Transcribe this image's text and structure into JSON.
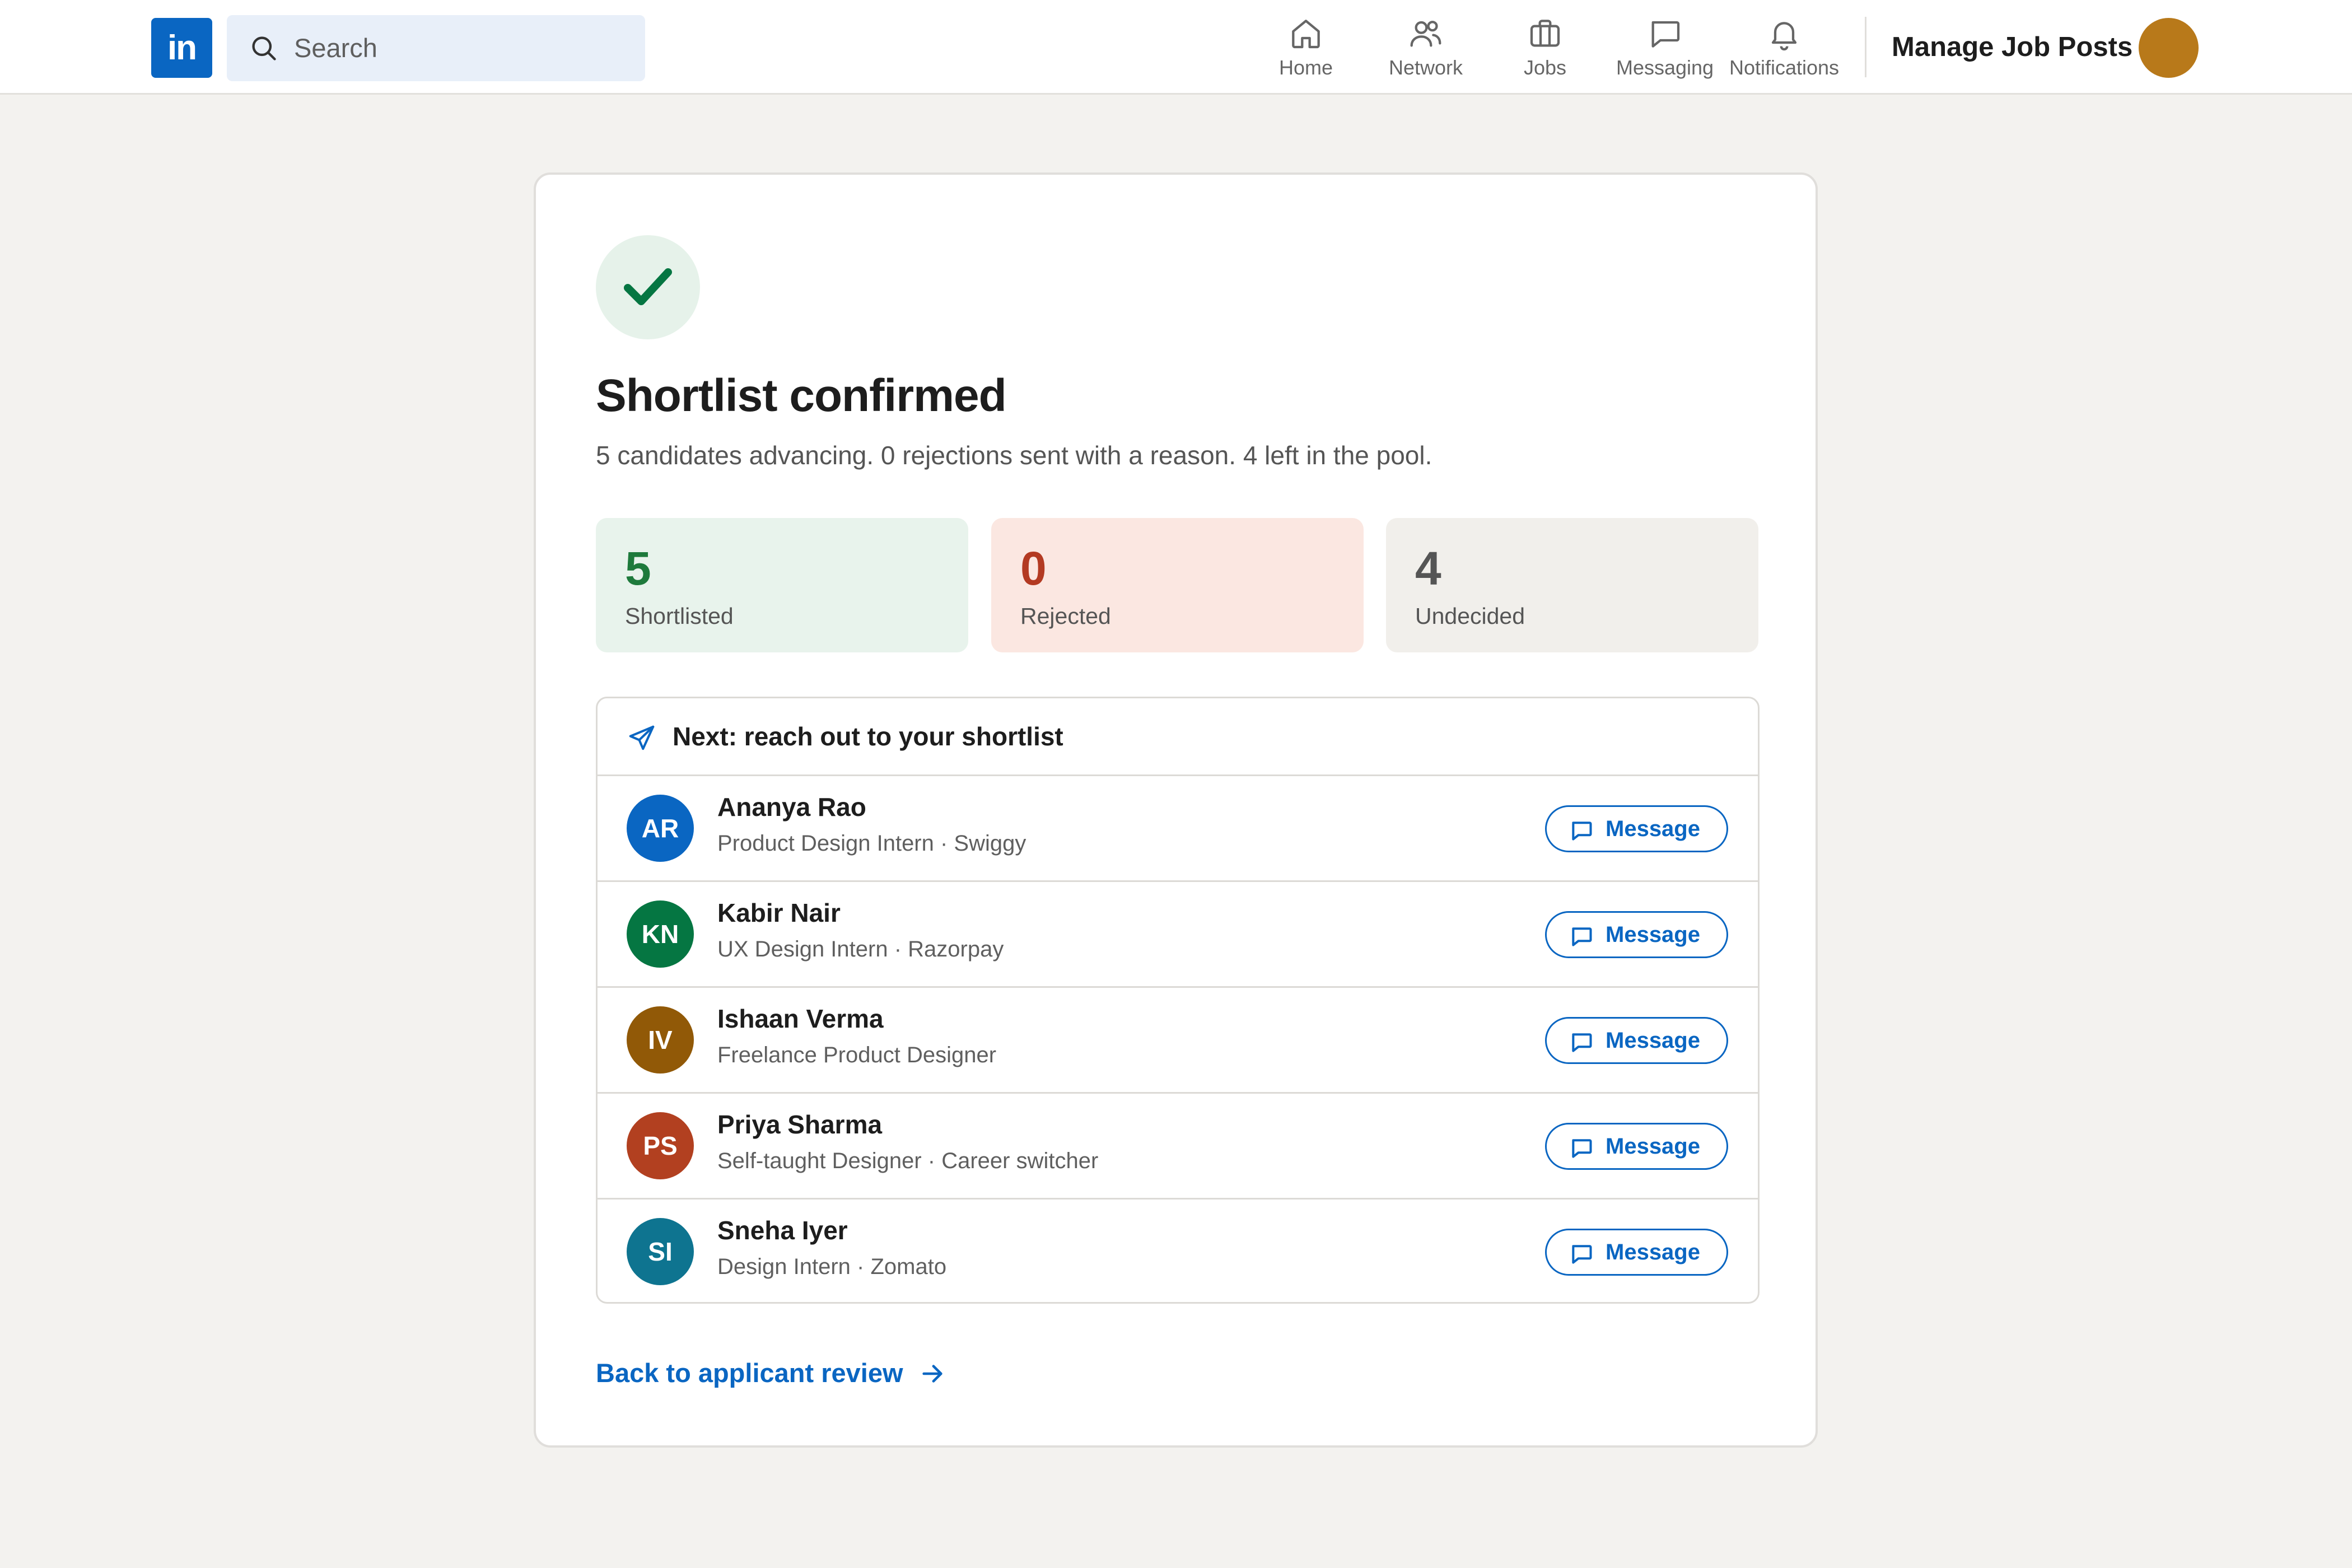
{
  "nav": {
    "logo_text": "in",
    "search_placeholder": "Search",
    "items": [
      {
        "label": "Home",
        "icon": "home-icon"
      },
      {
        "label": "Network",
        "icon": "network-icon"
      },
      {
        "label": "Jobs",
        "icon": "briefcase-icon"
      },
      {
        "label": "Messaging",
        "icon": "chat-icon"
      },
      {
        "label": "Notifications",
        "icon": "bell-icon"
      }
    ],
    "manage_label": "Manage Job Posts",
    "avatar_color": "#b8791a"
  },
  "confirm": {
    "title": "Shortlist confirmed",
    "subtitle": "5 candidates advancing. 0 rejections sent with a reason. 4 left in the pool.",
    "stats": [
      {
        "value": "5",
        "label": "Shortlisted",
        "color": "#1e7a3c"
      },
      {
        "value": "0",
        "label": "Rejected",
        "color": "#b33a22"
      },
      {
        "value": "4",
        "label": "Undecided",
        "color": "#555555"
      }
    ],
    "next_heading": "Next: reach out to your shortlist",
    "message_label": "Message",
    "candidates": [
      {
        "initials": "AR",
        "name": "Ananya Rao",
        "subtitle": "Product Design Intern · Swiggy",
        "color": "#0a66c2"
      },
      {
        "initials": "KN",
        "name": "Kabir Nair",
        "subtitle": "UX Design Intern · Razorpay",
        "color": "#057642"
      },
      {
        "initials": "IV",
        "name": "Ishaan Verma",
        "subtitle": "Freelance Product Designer",
        "color": "#915907"
      },
      {
        "initials": "PS",
        "name": "Priya Sharma",
        "subtitle": "Self-taught Designer · Career switcher",
        "color": "#b24020"
      },
      {
        "initials": "SI",
        "name": "Sneha Iyer",
        "subtitle": "Design Intern · Zomato",
        "color": "#0e7490"
      }
    ],
    "back_link": "Back to applicant review"
  },
  "colors": {
    "brand": "#0a66c2",
    "page_bg": "#f3f2ef",
    "success": "#1e7a3c"
  }
}
